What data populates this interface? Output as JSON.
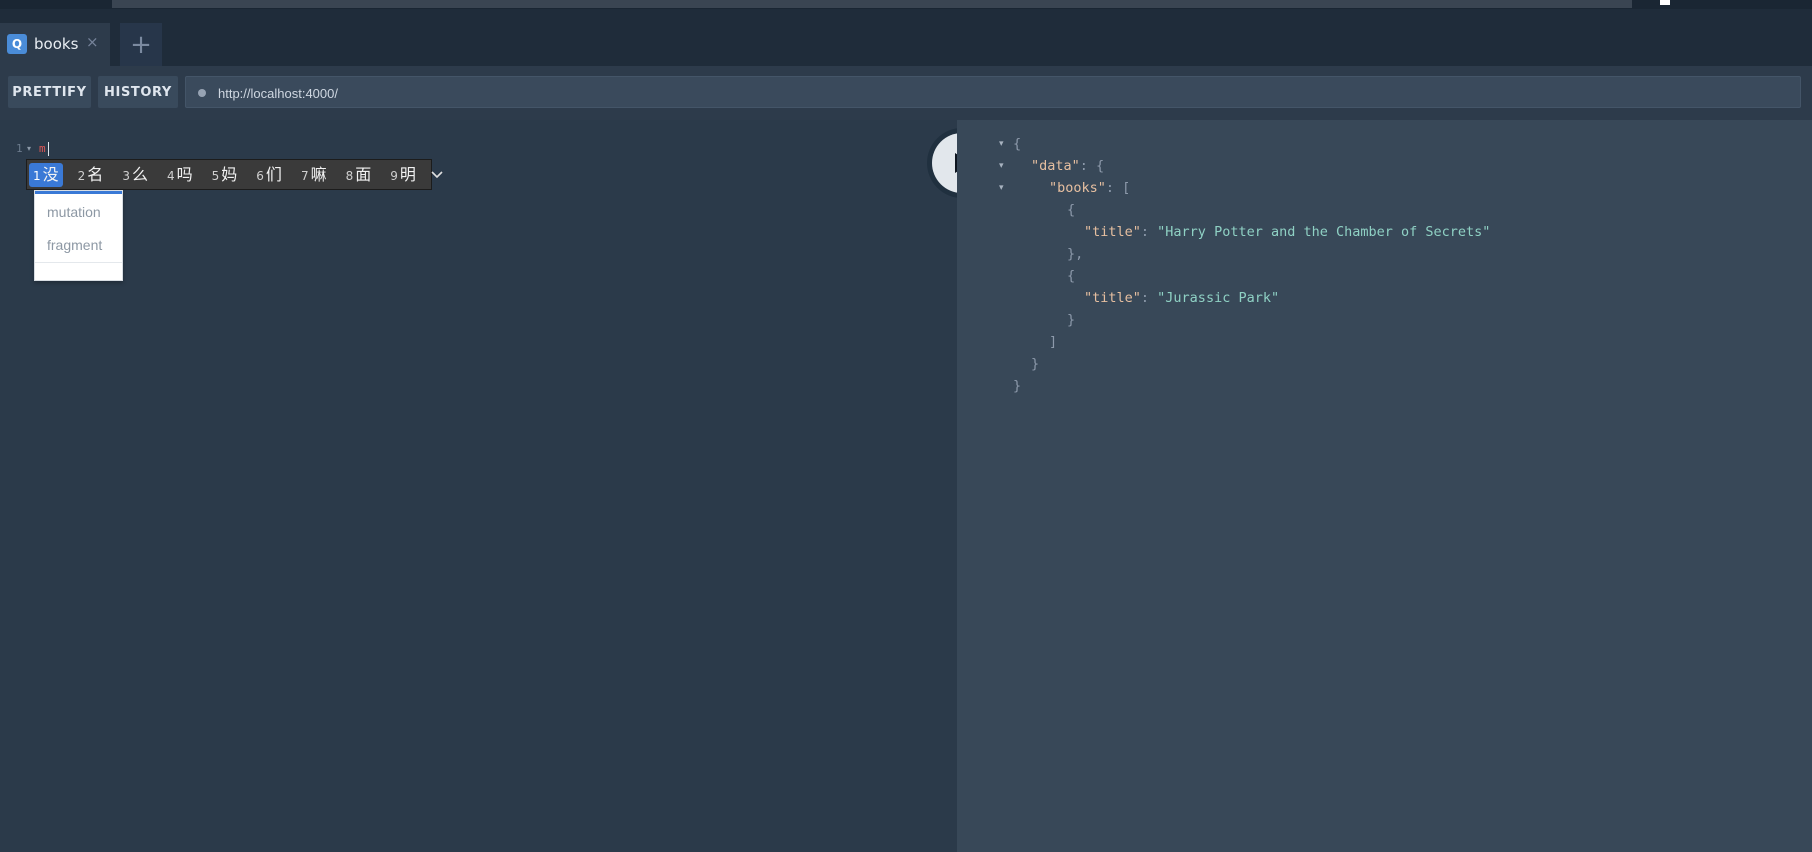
{
  "tab": {
    "icon_letter": "Q",
    "label": "books",
    "close_glyph": "×",
    "add_glyph": "+"
  },
  "toolbar": {
    "prettify": "PRETTIFY",
    "history": "HISTORY",
    "url": "http://localhost:4000/"
  },
  "editor": {
    "line_number": "1",
    "typed_text": "m"
  },
  "ime": {
    "candidates": [
      {
        "n": "1",
        "c": "没"
      },
      {
        "n": "2",
        "c": "名"
      },
      {
        "n": "3",
        "c": "么"
      },
      {
        "n": "4",
        "c": "吗"
      },
      {
        "n": "5",
        "c": "妈"
      },
      {
        "n": "6",
        "c": "们"
      },
      {
        "n": "7",
        "c": "嘛"
      },
      {
        "n": "8",
        "c": "面"
      },
      {
        "n": "9",
        "c": "明"
      }
    ],
    "selected_index": 0
  },
  "autocomplete": {
    "items": [
      "mutation",
      "fragment"
    ]
  },
  "result": {
    "data_key": "\"data\"",
    "books_key": "\"books\"",
    "title_key": "\"title\"",
    "titles": [
      "\"Harry Potter and the Chamber of Secrets\"",
      "\"Jurassic Park\""
    ]
  },
  "colors": {
    "accent": "#3a79d6",
    "key": "#e6bfa0",
    "string": "#8fd1c4"
  },
  "icons": {
    "run": "play-icon",
    "url_status": "dot-icon",
    "ime_more": "chevron-down-icon"
  }
}
